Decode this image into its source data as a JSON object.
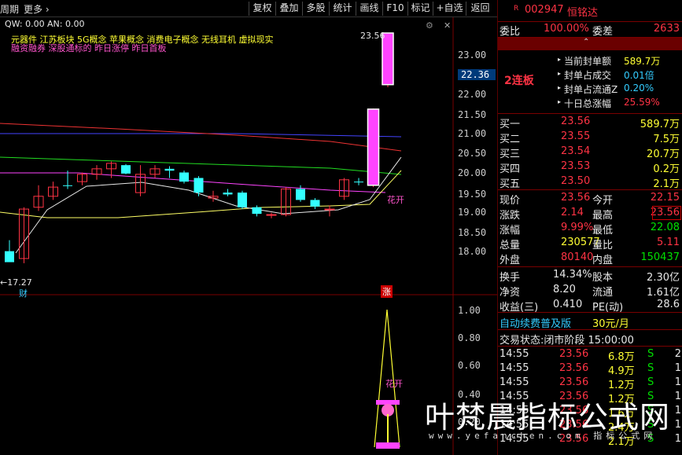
{
  "toolbar": {
    "period": "周期",
    "more": "更多",
    "buttons": [
      "复权",
      "叠加",
      "多股",
      "统计",
      "画线",
      "F10",
      "标记",
      "+自选",
      "返回"
    ]
  },
  "indicator": {
    "qw": "QW: 0.00",
    "an": "AN: 0.00",
    "concepts": "元器件 江苏板块 5G概念 苹果概念 消费电子概念 无线耳机 虚拟现实",
    "tags": "融资融券 深股通标的 昨日涨停 昨日首板",
    "top_price_label": "23.56",
    "low_price_label": "17.27",
    "cai_badge": "财",
    "zhang_badge": "涨",
    "flower_label": "花开",
    "flower_label2": "花开"
  },
  "price_axis": {
    "labels": [
      "23.00",
      "22.00",
      "21.50",
      "21.00",
      "20.50",
      "20.00",
      "19.50",
      "19.00",
      "18.50",
      "18.00"
    ],
    "current": "22.36"
  },
  "lower_axis": {
    "labels": [
      "1.00",
      "0.80",
      "0.60",
      "0.40",
      "0.20"
    ]
  },
  "chart_data": {
    "type": "candlestick",
    "candles": [
      {
        "o": 17.6,
        "h": 17.9,
        "l": 17.35,
        "c": 17.3,
        "up": false
      },
      {
        "o": 17.4,
        "h": 18.8,
        "l": 17.27,
        "c": 18.75,
        "up": true
      },
      {
        "o": 18.8,
        "h": 19.4,
        "l": 18.7,
        "c": 19.1,
        "up": true
      },
      {
        "o": 19.1,
        "h": 19.5,
        "l": 19.0,
        "c": 19.35,
        "up": true
      },
      {
        "o": 19.4,
        "h": 19.8,
        "l": 19.3,
        "c": 19.4,
        "up": false
      },
      {
        "o": 19.5,
        "h": 19.75,
        "l": 19.4,
        "c": 19.7,
        "up": true
      },
      {
        "o": 19.7,
        "h": 19.95,
        "l": 19.55,
        "c": 19.85,
        "up": true
      },
      {
        "o": 19.85,
        "h": 20.05,
        "l": 19.6,
        "c": 20.0,
        "up": true
      },
      {
        "o": 19.95,
        "h": 19.98,
        "l": 19.7,
        "c": 19.72,
        "up": false
      },
      {
        "o": 19.7,
        "h": 19.95,
        "l": 19.1,
        "c": 19.2,
        "up": true
      },
      {
        "o": 19.7,
        "h": 19.95,
        "l": 19.6,
        "c": 19.85,
        "up": true
      },
      {
        "o": 19.85,
        "h": 19.92,
        "l": 19.6,
        "c": 19.8,
        "up": false
      },
      {
        "o": 19.75,
        "h": 19.8,
        "l": 19.45,
        "c": 19.5,
        "up": false
      },
      {
        "o": 19.6,
        "h": 19.65,
        "l": 19.1,
        "c": 19.2,
        "up": false
      },
      {
        "o": 19.1,
        "h": 19.25,
        "l": 18.95,
        "c": 19.05,
        "up": true
      },
      {
        "o": 19.2,
        "h": 19.3,
        "l": 19.1,
        "c": 19.15,
        "up": false
      },
      {
        "o": 19.2,
        "h": 19.25,
        "l": 18.75,
        "c": 18.8,
        "up": false
      },
      {
        "o": 18.8,
        "h": 18.85,
        "l": 18.55,
        "c": 18.62,
        "up": false
      },
      {
        "o": 18.6,
        "h": 18.65,
        "l": 18.5,
        "c": 18.58,
        "up": true
      },
      {
        "o": 18.6,
        "h": 19.35,
        "l": 18.55,
        "c": 19.3,
        "up": true
      },
      {
        "o": 19.3,
        "h": 19.4,
        "l": 18.95,
        "c": 19.0,
        "up": false
      },
      {
        "o": 19.0,
        "h": 19.05,
        "l": 18.75,
        "c": 18.82,
        "up": false
      },
      {
        "o": 18.75,
        "h": 18.85,
        "l": 18.55,
        "c": 18.75,
        "up": true
      },
      {
        "o": 19.1,
        "h": 19.6,
        "l": 19.0,
        "c": 19.55,
        "up": true
      },
      {
        "o": 19.5,
        "h": 19.6,
        "l": 19.4,
        "c": 19.48,
        "up": false
      },
      {
        "o": 19.4,
        "h": 21.5,
        "l": 19.35,
        "c": 21.48,
        "up": true
      },
      {
        "o": 22.15,
        "h": 23.56,
        "l": 22.08,
        "c": 23.56,
        "up": true
      }
    ],
    "ylim": [
      17.27,
      23.56
    ]
  },
  "panel": {
    "code_prefix": "R",
    "code": "002947",
    "name": "恒铭达",
    "weibi_label": "委比",
    "weibi_value": "100.00%",
    "weicha_label": "委差",
    "weicha_value": "2633",
    "lianban": "2连板",
    "info": [
      {
        "label": "当前封单额",
        "value": "589.7万"
      },
      {
        "label": "封单占成交",
        "value": "0.01倍"
      },
      {
        "label": "封单占流通Z",
        "value": "0.20%"
      },
      {
        "label": "十日总涨幅",
        "value": "25.59%"
      }
    ],
    "buys": [
      {
        "label": "买一",
        "price": "23.56",
        "vol": "589.7万"
      },
      {
        "label": "买二",
        "price": "23.55",
        "vol": "7.5万"
      },
      {
        "label": "买三",
        "price": "23.54",
        "vol": "20.7万"
      },
      {
        "label": "买四",
        "price": "23.53",
        "vol": "0.2万"
      },
      {
        "label": "买五",
        "price": "23.50",
        "vol": "2.1万"
      }
    ],
    "quote": [
      {
        "l1": "现价",
        "v1": "23.56",
        "l2": "今开",
        "v2": "22.15"
      },
      {
        "l1": "涨跌",
        "v1": "2.14",
        "l2": "最高",
        "v2": "23.56"
      },
      {
        "l1": "涨幅",
        "v1": "9.99%",
        "l2": "最低",
        "v2": "22.08"
      },
      {
        "l1": "总量",
        "v1": "230577",
        "l2": "量比",
        "v2": "5.11"
      },
      {
        "l1": "外盘",
        "v1": "80140",
        "l2": "内盘",
        "v2": "150437"
      }
    ],
    "stats": [
      {
        "l1": "换手",
        "v1": "14.34%",
        "l2": "股本",
        "v2": "2.30亿"
      },
      {
        "l1": "净资",
        "v1": "8.20",
        "l2": "流通",
        "v2": "1.61亿"
      },
      {
        "l1": "收益(三)",
        "v1": "0.410",
        "l2": "PE(动)",
        "v2": "28.6"
      }
    ],
    "promo": "自动续费普及版",
    "promo_price": "30元/月",
    "trade_status": "交易状态:闭市阶段 15:00:00",
    "ticks": [
      {
        "t": "14:55",
        "p": "23.56",
        "v": "6.8万",
        "s": "S",
        "n": "2"
      },
      {
        "t": "14:55",
        "p": "23.56",
        "v": "4.9万",
        "s": "S",
        "n": "1"
      },
      {
        "t": "14:55",
        "p": "23.56",
        "v": "1.2万",
        "s": "S",
        "n": "1"
      },
      {
        "t": "14:55",
        "p": "23.56",
        "v": "1.2万",
        "s": "S",
        "n": "1"
      },
      {
        "t": "14:55",
        "p": "23.56",
        "v": "1.6万",
        "s": "S",
        "n": "1"
      },
      {
        "t": "14:55",
        "p": "23.56",
        "v": "2.4万",
        "s": "S",
        "n": "1"
      },
      {
        "t": "14:55",
        "p": "23.56",
        "v": "2.1万",
        "s": "S",
        "n": "1"
      }
    ]
  },
  "watermark": {
    "title": "叶梵晨指标公式网",
    "url": "www.yefanchen.com 指标公式网"
  },
  "colors": {
    "up": "#ff3344",
    "down": "#33ffff",
    "ma_white": "#e8e8e8",
    "ma_yellow": "#ffff66",
    "ma_magenta": "#ff44ff",
    "ma_green": "#22dd22",
    "ma_red": "#ee3333",
    "ma_blue": "#4444ff"
  }
}
